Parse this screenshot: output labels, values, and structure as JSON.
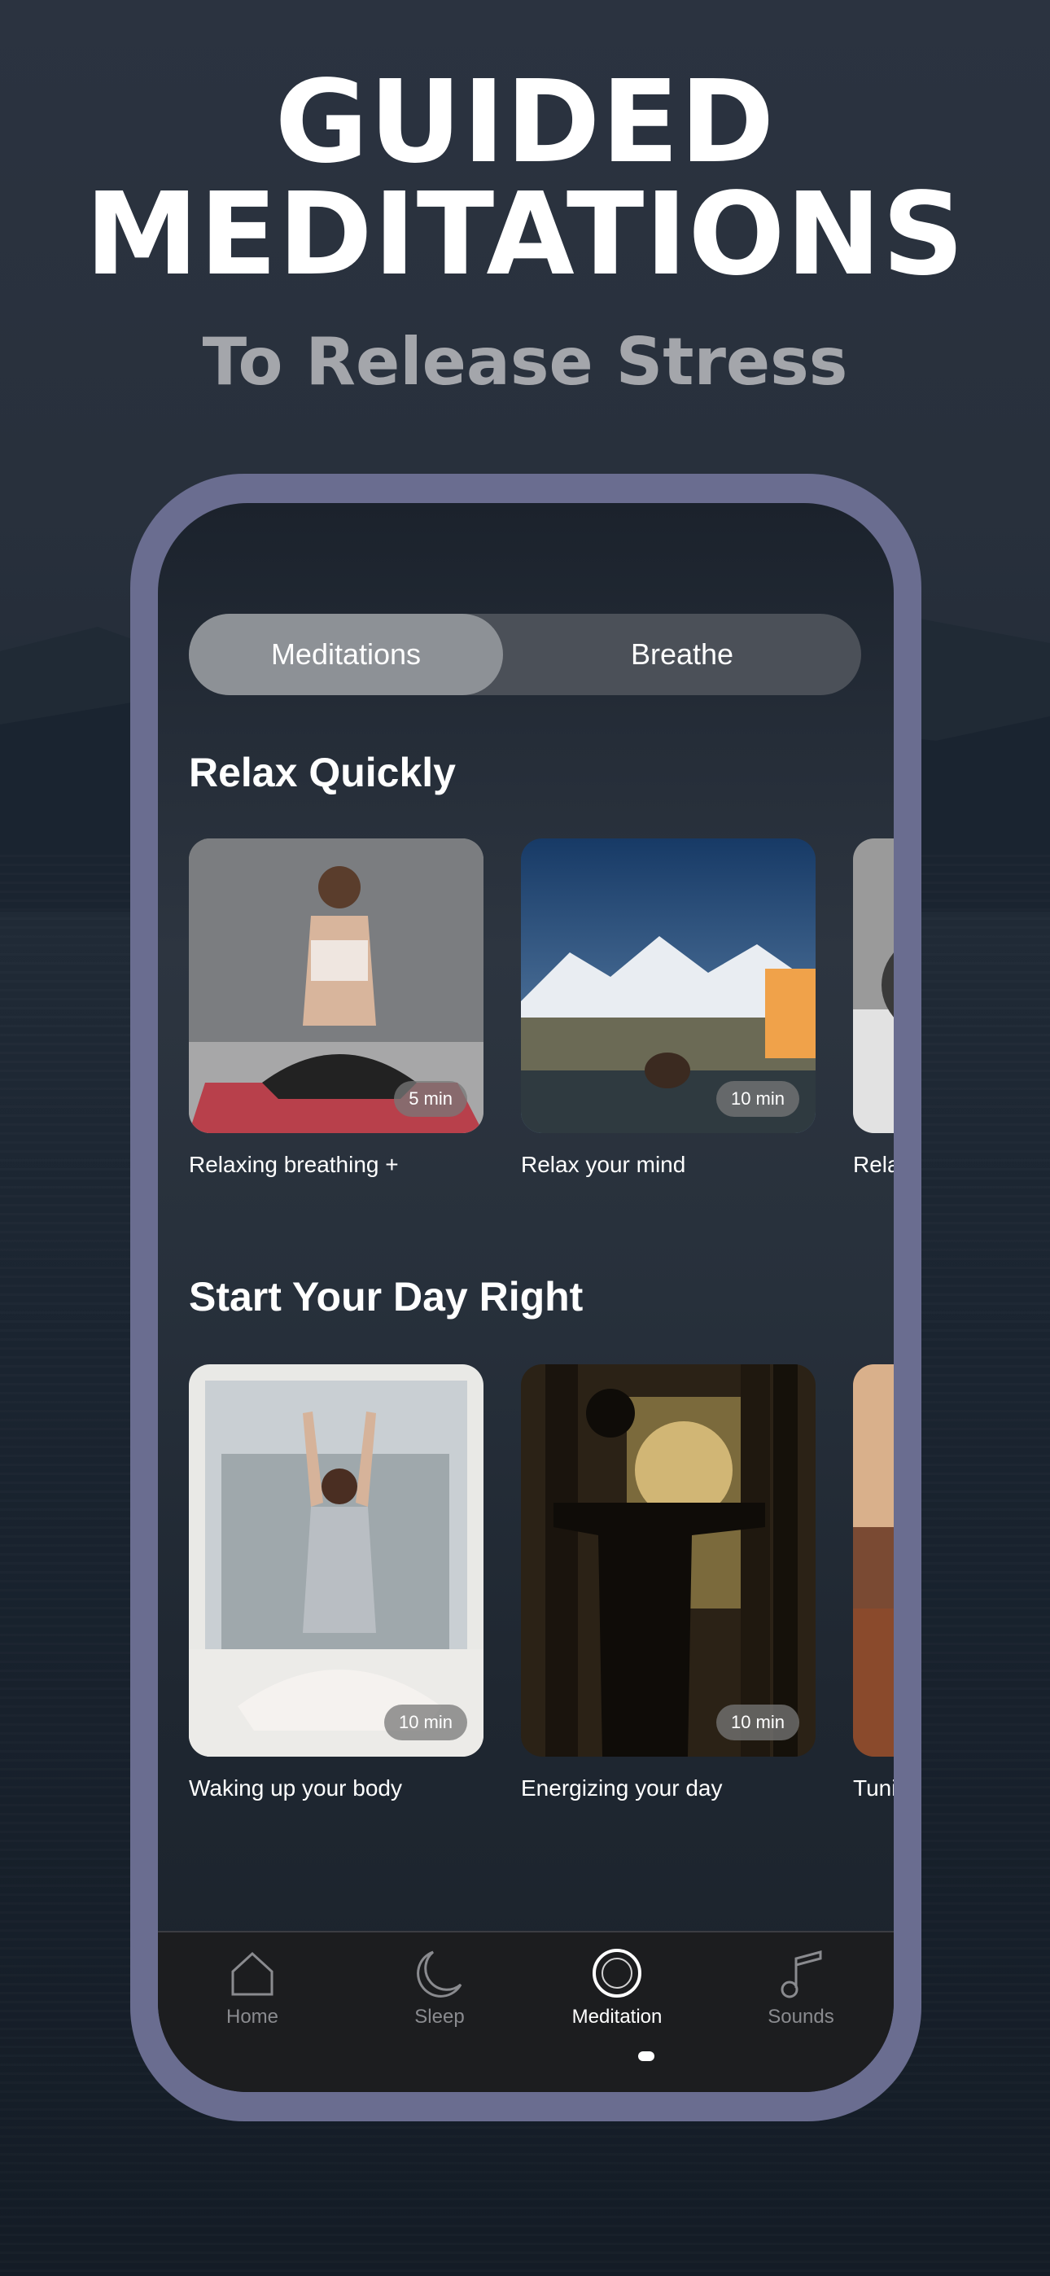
{
  "hero": {
    "title_line1": "GUIDED",
    "title_line2": "MEDITATIONS",
    "subtitle": "To Release Stress"
  },
  "segmented_control": {
    "options": [
      "Meditations",
      "Breathe"
    ],
    "selected": "Meditations"
  },
  "sections": [
    {
      "title": "Relax Quickly",
      "cards": [
        {
          "label": "Relaxing breathing +",
          "duration": "5 min"
        },
        {
          "label": "Relax your mind",
          "duration": "10 min"
        },
        {
          "label": "Relax your body",
          "duration": ""
        }
      ]
    },
    {
      "title": "Start Your Day Right",
      "cards": [
        {
          "label": "Waking up your body",
          "duration": "10 min"
        },
        {
          "label": "Energizing your day",
          "duration": "10 min"
        },
        {
          "label": "Tuning into life +",
          "duration": ""
        }
      ]
    }
  ],
  "tabbar": {
    "items": [
      {
        "label": "Home",
        "icon": "house-icon"
      },
      {
        "label": "Sleep",
        "icon": "moon-icon"
      },
      {
        "label": "Meditation",
        "icon": "meditation-circle-icon"
      },
      {
        "label": "Sounds",
        "icon": "music-note-icon"
      }
    ],
    "active": "Meditation"
  },
  "colors": {
    "phone_frame": "#6a6d90",
    "accent_white": "#ffffff",
    "muted_text": "#8a8b8f"
  }
}
